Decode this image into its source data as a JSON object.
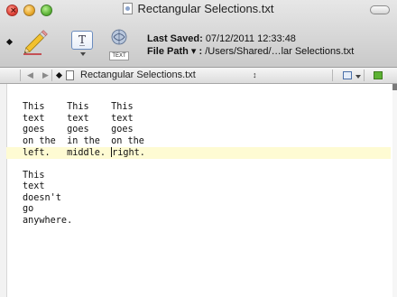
{
  "window": {
    "title": "Rectangular Selections.txt"
  },
  "toolbar": {
    "last_saved_label": "Last Saved:",
    "last_saved_value": "07/12/2011 12:33:48",
    "file_path_label": "File Path ▾ :",
    "file_path_value": "/Users/Shared/…lar Selections.txt",
    "text_icon_label": "TEXT",
    "tt_label": "T̲"
  },
  "navbar": {
    "back": "◀",
    "forward": "▶",
    "document_name": "Rectangular Selections.txt",
    "updown": "↕"
  },
  "editor": {
    "lines_before": [
      "This    This    This",
      "text    text    text",
      "goes    goes    goes",
      "on the  in the  on the"
    ],
    "current_line_before_caret": "left.   middle. ",
    "current_line_after_caret": "right.",
    "lines_after": [
      "",
      "This",
      "text",
      "doesn't",
      "go",
      "anywhere."
    ]
  },
  "colors": {
    "current_line_highlight": "#fefbd3",
    "close_button": "#e0443a",
    "minimize_button": "#e7a92c",
    "zoom_button": "#5fb43a"
  }
}
